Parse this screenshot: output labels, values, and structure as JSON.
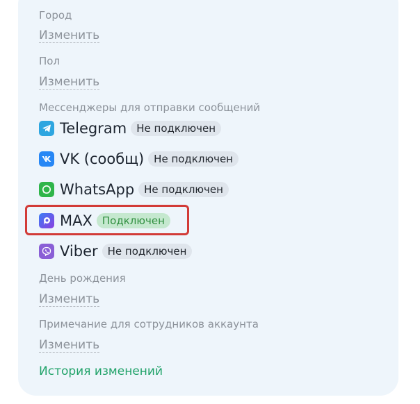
{
  "fields": {
    "city": {
      "label": "Город",
      "action": "Изменить"
    },
    "gender": {
      "label": "Пол",
      "action": "Изменить"
    },
    "birthday": {
      "label": "День рождения",
      "action": "Изменить"
    },
    "note": {
      "label": "Примечание для сотрудников аккаунта",
      "action": "Изменить"
    }
  },
  "messengers": {
    "label": "Мессенджеры для отправки сообщений",
    "items": [
      {
        "name": "Telegram",
        "status": "Не подключен",
        "icon": "telegram-icon",
        "color": "#2ea6e0"
      },
      {
        "name": "VK (сообщ)",
        "status": "Не подключен",
        "icon": "vk-icon",
        "color": "#2787f5"
      },
      {
        "name": "WhatsApp",
        "status": "Не подключен",
        "icon": "whatsapp-icon",
        "color": "#2fb54a"
      },
      {
        "name": "MAX",
        "status": "Подключен",
        "icon": "max-icon",
        "color": "#6a4df0"
      },
      {
        "name": "Viber",
        "status": "Не подключен",
        "icon": "viber-icon",
        "color": "#8a5fd6"
      }
    ]
  },
  "history_link": "История изменений",
  "colors": {
    "card_background": "#eef5fb",
    "connected_badge": "#c5e8cf",
    "connected_text": "#2f8f3f",
    "highlight_border": "#d23b37",
    "link_green": "#22a36a"
  }
}
